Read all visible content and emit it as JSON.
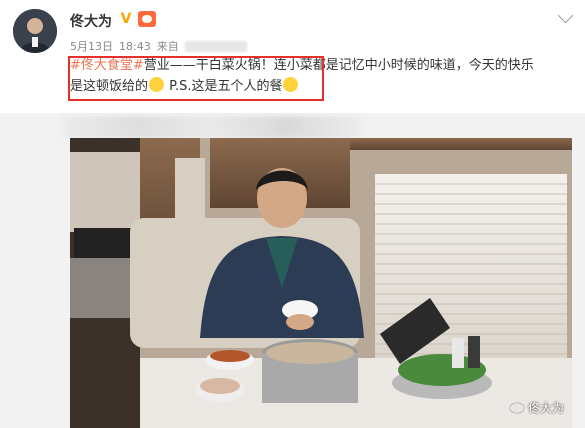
{
  "post": {
    "username": "佟大为",
    "meta": {
      "date": "5月13日",
      "time": "18:43",
      "source_prefix": "来自"
    },
    "text_parts": {
      "topic": "#佟大食堂#",
      "line1_rest": "营业——干白菜火锅！连小菜都是记忆中小时候的味道，今天的快乐",
      "line2_a": "是这顿饭给的",
      "line2_b": " P.S.这是五个人的餐"
    },
    "watermark": "佟大为"
  },
  "icons": {
    "verified": "verified-v-icon",
    "vip": "vip-badge-icon",
    "chevron": "chevron-down-icon",
    "emoji_grin": "grin-emoji-icon",
    "emoji_doge": "doge-emoji-icon"
  },
  "colors": {
    "topic": "#eb7350",
    "highlight": "#e4312b",
    "verified": "#f7a800"
  }
}
